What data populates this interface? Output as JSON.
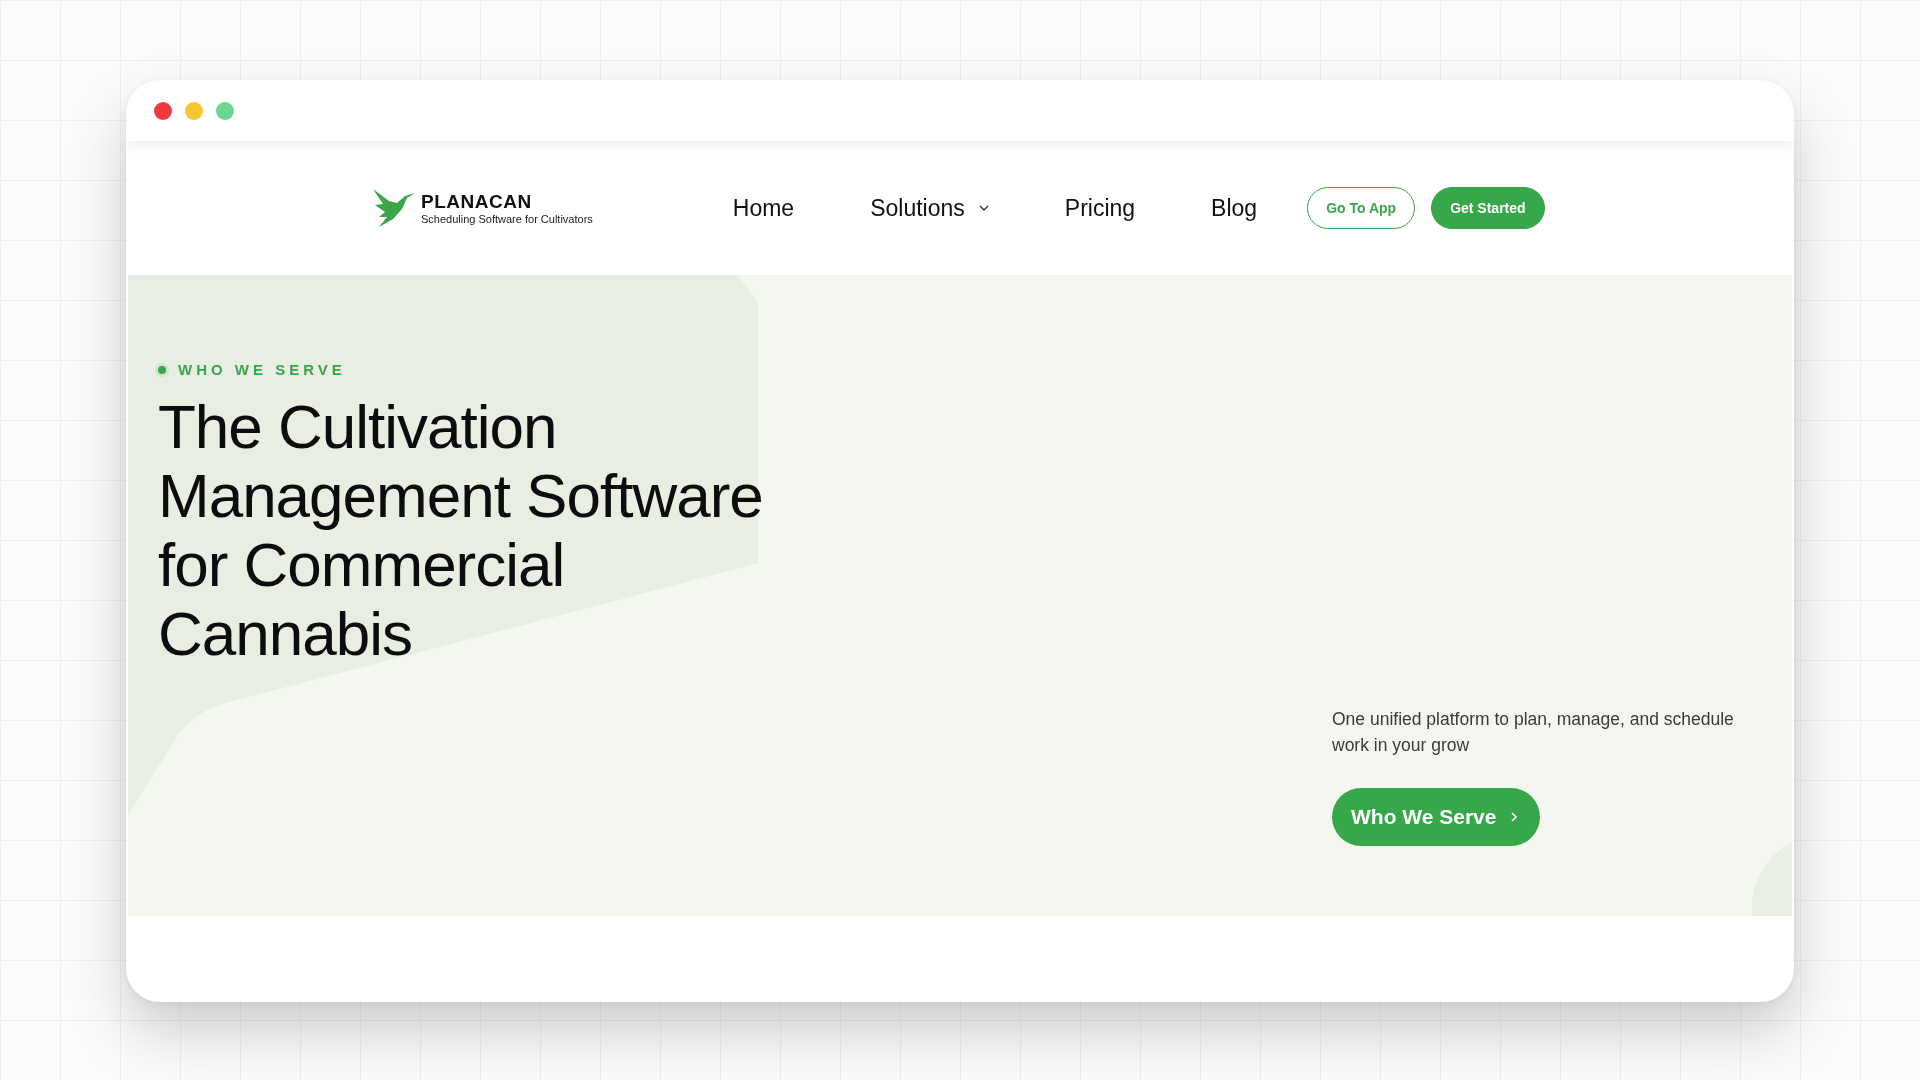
{
  "window": {
    "controls": [
      {
        "color": "#f0393f"
      },
      {
        "color": "#f7c531"
      },
      {
        "color": "#6ad68e"
      }
    ]
  },
  "logo": {
    "name": "PLANACAN",
    "tagline": "Scheduling Software for Cultivators"
  },
  "nav": {
    "links": [
      {
        "label": "Home",
        "dropdown": false
      },
      {
        "label": "Solutions",
        "dropdown": true
      },
      {
        "label": "Pricing",
        "dropdown": false
      },
      {
        "label": "Blog",
        "dropdown": false
      }
    ],
    "buttons": [
      {
        "label": "Go To App",
        "kind": "outline"
      },
      {
        "label": "Get Started",
        "kind": "filled"
      }
    ]
  },
  "hero": {
    "eyebrow": "WHO WE SERVE",
    "headline": "The Cultivation Management Software for Commercial Cannabis",
    "description": "One unified platform to plan, manage, and schedule work in your grow",
    "cta": "Who We Serve"
  }
}
